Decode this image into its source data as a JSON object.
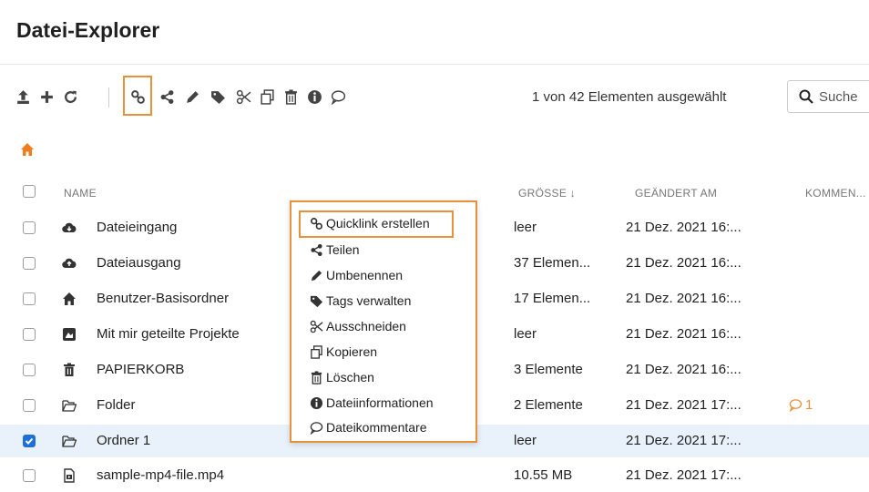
{
  "page": {
    "title": "Datei-Explorer"
  },
  "toolbar": {
    "items": [
      {
        "name": "upload-icon"
      },
      {
        "name": "plus-icon"
      },
      {
        "name": "refresh-icon"
      },
      {
        "name": "quicklink-icon"
      },
      {
        "name": "share-icon"
      },
      {
        "name": "pencil-icon"
      },
      {
        "name": "tag-icon"
      },
      {
        "name": "scissors-icon"
      },
      {
        "name": "copy-icon"
      },
      {
        "name": "trash-icon"
      },
      {
        "name": "info-icon"
      },
      {
        "name": "comment-icon"
      }
    ],
    "selection_info": "1 von 42 Elementen ausgewählt"
  },
  "search": {
    "value": "Suche",
    "icon": "search-icon"
  },
  "breadcrumb": {
    "icon": "home-icon"
  },
  "table": {
    "headers": {
      "name": "NAME",
      "size": "GRÖSSE ↓",
      "date": "GEÄNDERT AM",
      "comments": "KOMMEN..."
    },
    "rows": [
      {
        "icon": "cloud-download-icon",
        "name": "Dateieingang",
        "size": "leer",
        "date": "21 Dez. 2021 16:...",
        "comments": "",
        "checked": false
      },
      {
        "icon": "cloud-upload-icon",
        "name": "Dateiausgang",
        "size": "37 Elemen...",
        "date": "21 Dez. 2021 16:...",
        "comments": "",
        "checked": false
      },
      {
        "icon": "home-icon",
        "name": "Benutzer-Basisordner",
        "size": "17 Elemen...",
        "date": "21 Dez. 2021 16:...",
        "comments": "",
        "checked": false
      },
      {
        "icon": "shared-projects-icon",
        "name": "Mit mir geteilte Projekte",
        "size": "leer",
        "date": "21 Dez. 2021 16:...",
        "comments": "",
        "checked": false
      },
      {
        "icon": "trash-icon",
        "name": "PAPIERKORB",
        "size": "3 Elemente",
        "date": "21 Dez. 2021 16:...",
        "comments": "",
        "checked": false
      },
      {
        "icon": "folder-icon",
        "name": "Folder",
        "size": "2 Elemente",
        "date": "21 Dez. 2021 17:...",
        "comments": "1",
        "checked": false
      },
      {
        "icon": "folder-icon",
        "name": "Ordner 1",
        "size": "leer",
        "date": "21 Dez. 2021 17:...",
        "comments": "",
        "checked": true
      },
      {
        "icon": "video-file-icon",
        "name": "sample-mp4-file.mp4",
        "size": "10.55 MB",
        "date": "21 Dez. 2021 17:...",
        "comments": "",
        "checked": false
      }
    ]
  },
  "context_menu": {
    "items": [
      {
        "icon": "quicklink-icon",
        "label": "Quicklink erstellen"
      },
      {
        "icon": "share-icon",
        "label": "Teilen"
      },
      {
        "icon": "pencil-icon",
        "label": "Umbenennen"
      },
      {
        "icon": "tag-icon",
        "label": "Tags verwalten"
      },
      {
        "icon": "scissors-icon",
        "label": "Ausschneiden"
      },
      {
        "icon": "copy-icon",
        "label": "Kopieren"
      },
      {
        "icon": "trash-icon",
        "label": "Löschen"
      },
      {
        "icon": "info-icon",
        "label": "Dateiinformationen"
      },
      {
        "icon": "comment-icon",
        "label": "Dateikommentare"
      }
    ]
  },
  "colors": {
    "accent": "#e8913a",
    "checkbox_checked": "#1e6fd9",
    "selected_row": "#e9f2fb",
    "home_icon": "#f07c1e"
  }
}
